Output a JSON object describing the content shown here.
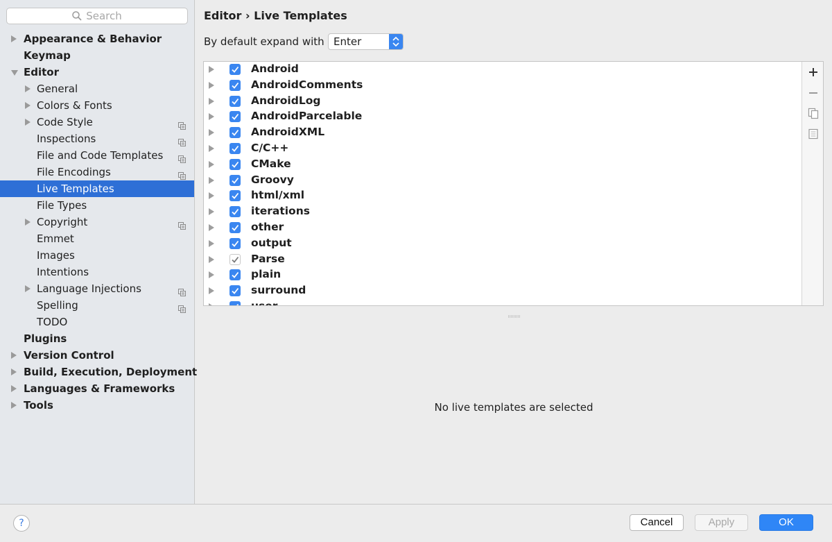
{
  "search": {
    "placeholder": "Search"
  },
  "sidebar": {
    "items": [
      {
        "label": "Appearance & Behavior",
        "level": 0,
        "arrow": "right",
        "project": false,
        "selected": false
      },
      {
        "label": "Keymap",
        "level": 0,
        "arrow": "none",
        "project": false,
        "selected": false
      },
      {
        "label": "Editor",
        "level": 0,
        "arrow": "down",
        "project": false,
        "selected": false
      },
      {
        "label": "General",
        "level": 1,
        "arrow": "right",
        "project": false,
        "selected": false
      },
      {
        "label": "Colors & Fonts",
        "level": 1,
        "arrow": "right",
        "project": false,
        "selected": false
      },
      {
        "label": "Code Style",
        "level": 1,
        "arrow": "right",
        "project": true,
        "selected": false
      },
      {
        "label": "Inspections",
        "level": 1,
        "arrow": "none",
        "project": true,
        "selected": false
      },
      {
        "label": "File and Code Templates",
        "level": 1,
        "arrow": "none",
        "project": true,
        "selected": false
      },
      {
        "label": "File Encodings",
        "level": 1,
        "arrow": "none",
        "project": true,
        "selected": false
      },
      {
        "label": "Live Templates",
        "level": 1,
        "arrow": "none",
        "project": false,
        "selected": true
      },
      {
        "label": "File Types",
        "level": 1,
        "arrow": "none",
        "project": false,
        "selected": false
      },
      {
        "label": "Copyright",
        "level": 1,
        "arrow": "right",
        "project": true,
        "selected": false
      },
      {
        "label": "Emmet",
        "level": 1,
        "arrow": "none",
        "project": false,
        "selected": false
      },
      {
        "label": "Images",
        "level": 1,
        "arrow": "none",
        "project": false,
        "selected": false
      },
      {
        "label": "Intentions",
        "level": 1,
        "arrow": "none",
        "project": false,
        "selected": false
      },
      {
        "label": "Language Injections",
        "level": 1,
        "arrow": "right",
        "project": true,
        "selected": false
      },
      {
        "label": "Spelling",
        "level": 1,
        "arrow": "none",
        "project": true,
        "selected": false
      },
      {
        "label": "TODO",
        "level": 1,
        "arrow": "none",
        "project": false,
        "selected": false
      },
      {
        "label": "Plugins",
        "level": 0,
        "arrow": "none",
        "project": false,
        "selected": false
      },
      {
        "label": "Version Control",
        "level": 0,
        "arrow": "right",
        "project": false,
        "selected": false
      },
      {
        "label": "Build, Execution, Deployment",
        "level": 0,
        "arrow": "right",
        "project": false,
        "selected": false
      },
      {
        "label": "Languages & Frameworks",
        "level": 0,
        "arrow": "right",
        "project": false,
        "selected": false
      },
      {
        "label": "Tools",
        "level": 0,
        "arrow": "right",
        "project": false,
        "selected": false
      }
    ]
  },
  "main": {
    "breadcrumb": "Editor › Live Templates",
    "expand_label": "By default expand with",
    "expand_value": "Enter",
    "templates": [
      {
        "label": "Android",
        "checked": "full"
      },
      {
        "label": "AndroidComments",
        "checked": "full"
      },
      {
        "label": "AndroidLog",
        "checked": "full"
      },
      {
        "label": "AndroidParcelable",
        "checked": "full"
      },
      {
        "label": "AndroidXML",
        "checked": "full"
      },
      {
        "label": "C/C++",
        "checked": "full"
      },
      {
        "label": "CMake",
        "checked": "full"
      },
      {
        "label": "Groovy",
        "checked": "full"
      },
      {
        "label": "html/xml",
        "checked": "full"
      },
      {
        "label": "iterations",
        "checked": "full"
      },
      {
        "label": "other",
        "checked": "full"
      },
      {
        "label": "output",
        "checked": "full"
      },
      {
        "label": "Parse",
        "checked": "partial"
      },
      {
        "label": "plain",
        "checked": "full"
      },
      {
        "label": "surround",
        "checked": "full"
      },
      {
        "label": "user",
        "checked": "full"
      }
    ],
    "empty_message": "No live templates are selected"
  },
  "buttons": {
    "help": "?",
    "cancel": "Cancel",
    "apply": "Apply",
    "ok": "OK"
  },
  "colors": {
    "accent": "#3a86f0",
    "selection": "#2e6fd6"
  },
  "icons": {
    "search": "search-icon",
    "add": "plus-icon",
    "remove": "minus-icon",
    "copy": "copy-icon",
    "restore": "restore-defaults-icon",
    "project": "project-level-icon"
  }
}
